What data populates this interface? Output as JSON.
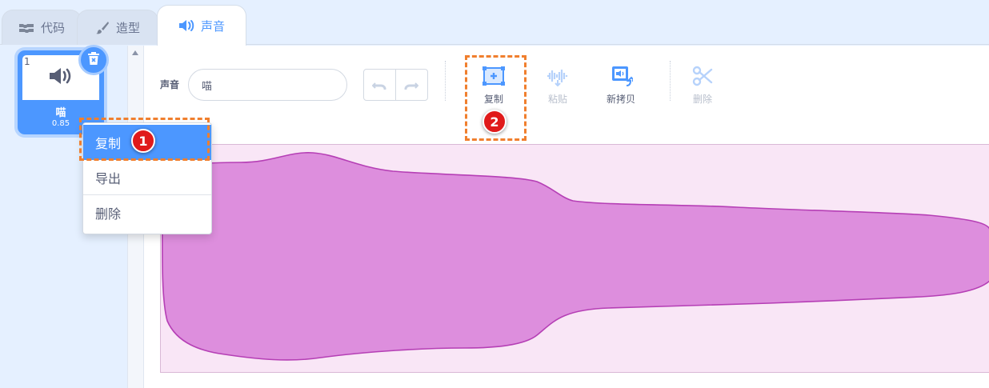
{
  "tabs": [
    {
      "label": "代码",
      "icon": "code-blocks-icon"
    },
    {
      "label": "造型",
      "icon": "brush-icon"
    },
    {
      "label": "声音",
      "icon": "speaker-icon",
      "active": true
    }
  ],
  "sound_list": {
    "items": [
      {
        "index": "1",
        "name": "喵",
        "duration": "0.85",
        "selected": true
      }
    ]
  },
  "context_menu": {
    "items": [
      {
        "label": "复制",
        "highlighted": true
      },
      {
        "label": "导出"
      },
      {
        "label": "删除"
      }
    ]
  },
  "editor": {
    "name_label": "声音",
    "name_value": "喵",
    "tools": [
      {
        "label": "复制",
        "icon": "copy-icon",
        "enabled": true
      },
      {
        "label": "粘贴",
        "icon": "paste-icon",
        "enabled": false
      },
      {
        "label": "新拷贝",
        "icon": "new-copy-icon",
        "enabled": true
      },
      {
        "label": "删除",
        "icon": "scissors-icon",
        "enabled": false
      }
    ]
  },
  "annotations": {
    "step1": "1",
    "step2": "2"
  },
  "colors": {
    "accent": "#4c97ff",
    "waveform_fill": "#dd8edd",
    "waveform_stroke": "#b53fb5",
    "waveform_bg": "#f9e6f6",
    "highlight": "#f07f2e",
    "badge": "#e01a1a"
  }
}
